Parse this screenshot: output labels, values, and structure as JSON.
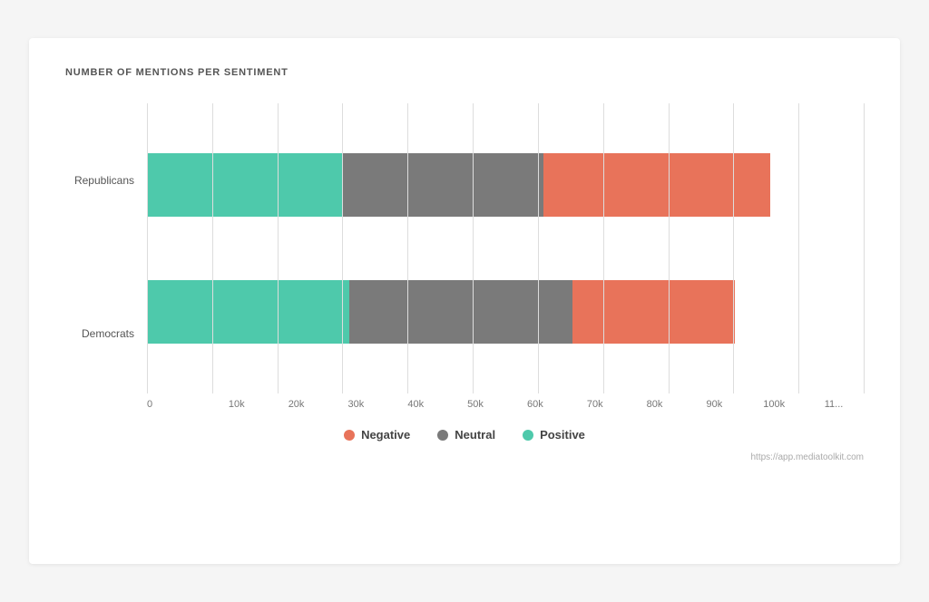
{
  "chart": {
    "title": "NUMBER OF MENTIONS PER SENTIMENT",
    "colors": {
      "positive": "#4ec9ab",
      "neutral": "#7a7a7a",
      "negative": "#e8735a"
    },
    "y_labels": [
      "Republicans",
      "Democrats"
    ],
    "bars": [
      {
        "label": "Republicans",
        "positive_pct": 30.5,
        "neutral_pct": 30.0,
        "negative_pct": 35.5
      },
      {
        "label": "Democrats",
        "positive_pct": 30.5,
        "neutral_pct": 32.0,
        "negative_pct": 31.0
      }
    ],
    "x_axis": {
      "ticks": [
        "0",
        "10k",
        "20k",
        "30k",
        "40k",
        "50k",
        "60k",
        "70k",
        "80k",
        "90k",
        "100k",
        "11..."
      ]
    },
    "legend": [
      {
        "label": "Negative",
        "color": "#e8735a"
      },
      {
        "label": "Neutral",
        "color": "#7a7a7a"
      },
      {
        "label": "Positive",
        "color": "#4ec9ab"
      }
    ],
    "watermark": "https://app.mediatoolkit.com"
  }
}
